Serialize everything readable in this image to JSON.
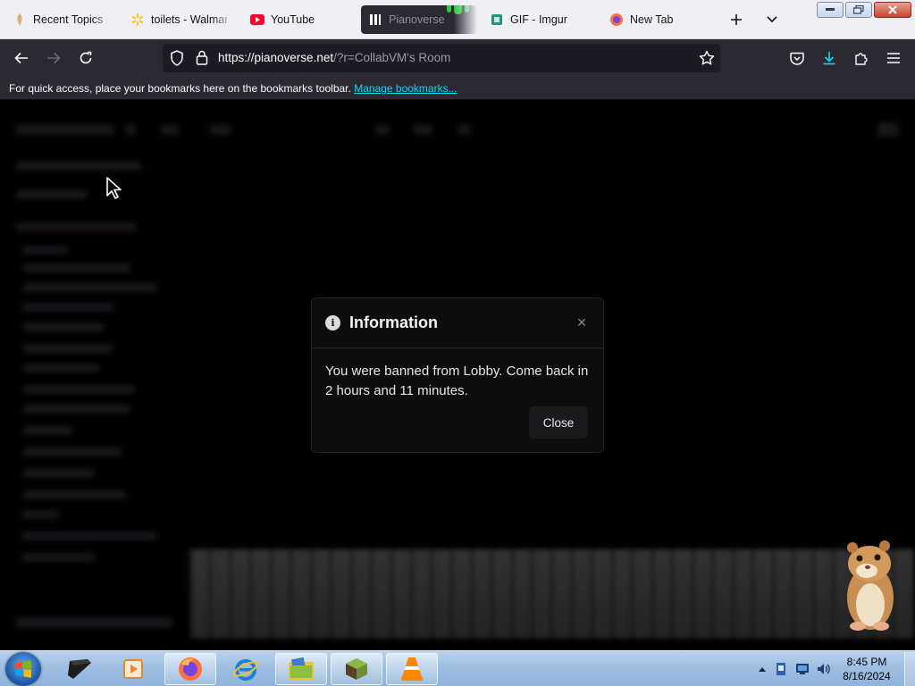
{
  "browser": {
    "tabs": [
      {
        "label": "Recent Topics | n",
        "favicon": "recent-topics-favicon"
      },
      {
        "label": "toilets - Walmart.",
        "favicon": "walmart-favicon"
      },
      {
        "label": "YouTube",
        "favicon": "youtube-favicon"
      },
      {
        "label": "Pianoverse",
        "favicon": "pianoverse-favicon",
        "active": true
      },
      {
        "label": "GIF - Imgur",
        "favicon": "imgur-favicon"
      },
      {
        "label": "New Tab",
        "favicon": "firefox-favicon"
      }
    ],
    "url": {
      "host": "https://pianoverse.net",
      "rest": "/?r=CollabVM's Room"
    },
    "bookmarks": {
      "hint": "For quick access, place your bookmarks here on the bookmarks toolbar.",
      "link": "Manage bookmarks..."
    }
  },
  "modal": {
    "title": "Information",
    "message": "You were banned from Lobby. Come back in 2 hours and 11 minutes.",
    "close_label": "Close",
    "info_glyph": "i",
    "x_glyph": "×"
  },
  "taskbar": {
    "items": [
      "firefox",
      "internet-explorer",
      "file-manager",
      "minecraft",
      "vlc"
    ],
    "time": "8:45 PM",
    "date": "8/16/2024"
  },
  "colors": {
    "accent_download": "#00ddff",
    "link": "#00ddff"
  }
}
